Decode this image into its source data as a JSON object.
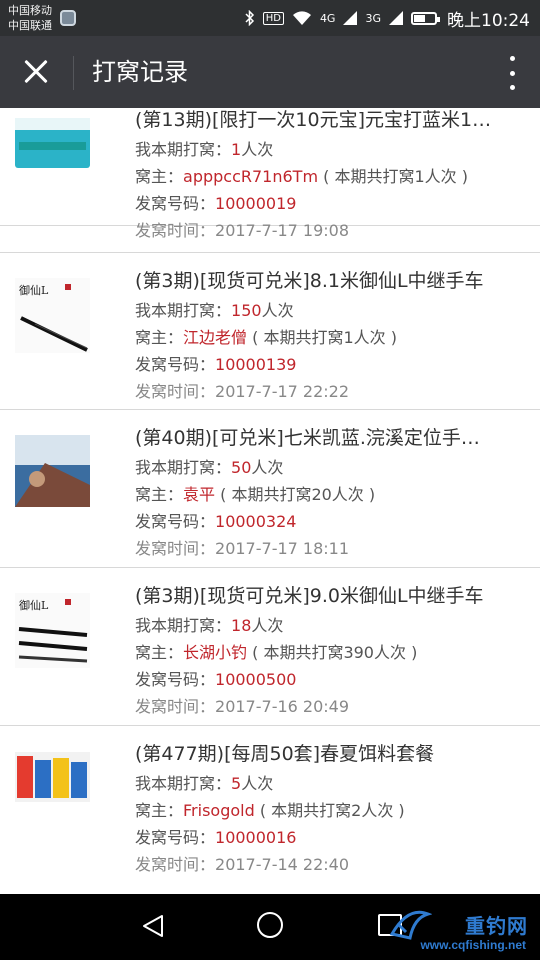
{
  "status_bar": {
    "carrier_1": "中国移动",
    "carrier_2": "中国联通",
    "hd": "HD",
    "net_1": "4G",
    "net_2": "3G",
    "time": "晚上10:24",
    "battery_level": 0.55
  },
  "header": {
    "title": "打窝记录",
    "close_icon": "close-icon",
    "more_icon": "more-vertical-icon"
  },
  "labels": {
    "my_count": "我本期打窝：",
    "owner": "窝主：",
    "code": "发窝号码：",
    "time": "发窝时间：",
    "count_unit": "人次"
  },
  "records": [
    {
      "title": "(第13期)[限打一次10元宝]元宝打蓝米1…",
      "my_count": "1",
      "owner": "apppccR71n6Tm",
      "owner_total": " ( 本期共打窝1人次 )",
      "code": "10000019",
      "time": "2017-7-17 19:08"
    },
    {
      "title": "(第3期)[现货可兑米]8.1米御仙L中继手车",
      "my_count": "150",
      "owner": "江边老僧",
      "owner_total": " ( 本期共打窝1人次 )",
      "code": "10000139",
      "time": "2017-7-17 22:22"
    },
    {
      "title": "(第40期)[可兑米]七米凯蓝.浣溪定位手…",
      "my_count": "50",
      "owner": "袁平",
      "owner_total": " ( 本期共打窝20人次 )",
      "code": "10000324",
      "time": "2017-7-17 18:11"
    },
    {
      "title": "(第3期)[现货可兑米]9.0米御仙L中继手车",
      "my_count": "18",
      "owner": "长湖小钓",
      "owner_total": " ( 本期共打窝390人次 )",
      "code": "10000500",
      "time": "2017-7-16 20:49"
    },
    {
      "title": "(第477期)[每周50套]春夏饵料套餐",
      "my_count": "5",
      "owner": "Frisogold",
      "owner_total": " ( 本期共打窝2人次 )",
      "code": "10000016",
      "time": "2017-7-14 22:40"
    }
  ],
  "nav": {
    "back_icon": "back-triangle-icon",
    "home_icon": "home-circle-icon",
    "recent_icon": "recent-square-icon"
  },
  "watermark": {
    "name": "重钓网",
    "url": "www.cqfishing.net"
  }
}
